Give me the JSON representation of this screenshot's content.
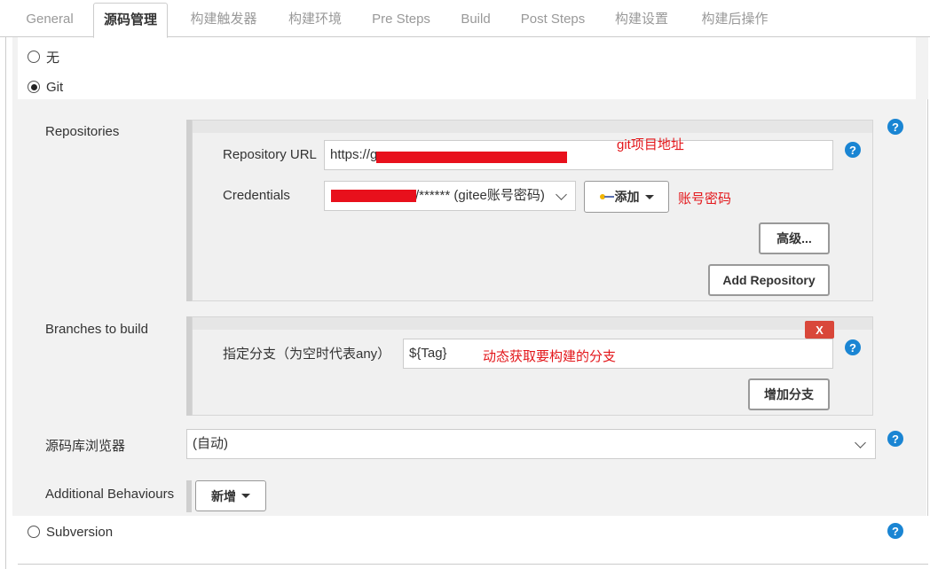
{
  "tabs": [
    "General",
    "源码管理",
    "构建触发器",
    "构建环境",
    "Pre Steps",
    "Build",
    "Post Steps",
    "构建设置",
    "构建后操作"
  ],
  "active_tab": "源码管理",
  "scm": {
    "none_label": "无",
    "git_label": "Git",
    "subversion_label": "Subversion"
  },
  "repositories": {
    "label": "Repositories",
    "url_label": "Repository URL",
    "url_value": "https://g",
    "url_annotation": "git项目地址",
    "credentials_label": "Credentials",
    "credentials_value": "/****** (gitee账号密码)",
    "add_label": "添加",
    "credentials_annotation": "账号密码",
    "advanced_label": "高级...",
    "add_repository_label": "Add Repository"
  },
  "branches": {
    "label": "Branches to build",
    "delete_label": "X",
    "specifier_label": "指定分支（为空时代表any）",
    "specifier_value": "${Tag}",
    "specifier_annotation": "动态获取要构建的分支",
    "add_branch_label": "增加分支"
  },
  "browser": {
    "label": "源码库浏览器",
    "value": "(自动)"
  },
  "behaviours": {
    "label": "Additional Behaviours",
    "add_label": "新增"
  },
  "help_glyph": "?",
  "colors": {
    "accent_help": "#1a85d3",
    "annotation_red": "#e3161a",
    "delete_red": "#d9473a"
  }
}
